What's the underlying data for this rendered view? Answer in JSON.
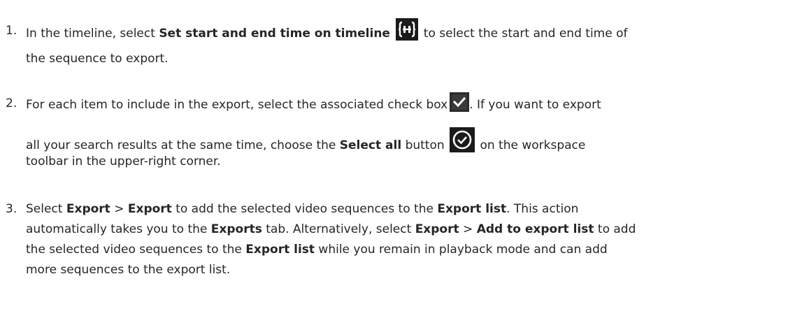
{
  "steps": [
    {
      "number": "1.",
      "line1_a": "In the timeline, select ",
      "line1_b": "Set start and end time on timeline",
      "line1_c": " to select the start and end time of",
      "line2": "the sequence to export."
    },
    {
      "number": "2.",
      "line1_a": "For each item to include in the export, select the associated check box",
      "line1_b": ". If you want to export",
      "line2_a": "all your search results at the same time, choose the ",
      "line2_b": "Select all",
      "line2_c": " button",
      "line2_d": " on the workspace",
      "line3": "toolbar in the upper-right corner."
    },
    {
      "number": "3.",
      "l1_a": "Select ",
      "l1_b": "Export",
      "l1_c": " > ",
      "l1_d": "Export",
      "l1_e": " to add the selected video sequences to the ",
      "l1_f": "Export list",
      "l1_g": ". This action",
      "l2_a": "automatically takes you to the ",
      "l2_b": "Exports",
      "l2_c": " tab. Alternatively, select ",
      "l2_d": "Export",
      "l2_e": " > ",
      "l2_f": "Add to export list",
      "l2_g": " to add",
      "l3_a": "the selected video sequences to the ",
      "l3_b": "Export list",
      "l3_c": " while you remain in playback mode and can add",
      "l4": "more sequences to the export list."
    }
  ],
  "icons": {
    "timeline": "set-start-end-time-icon",
    "checkbox": "checkbox-checked-icon",
    "select_all": "select-all-icon"
  }
}
